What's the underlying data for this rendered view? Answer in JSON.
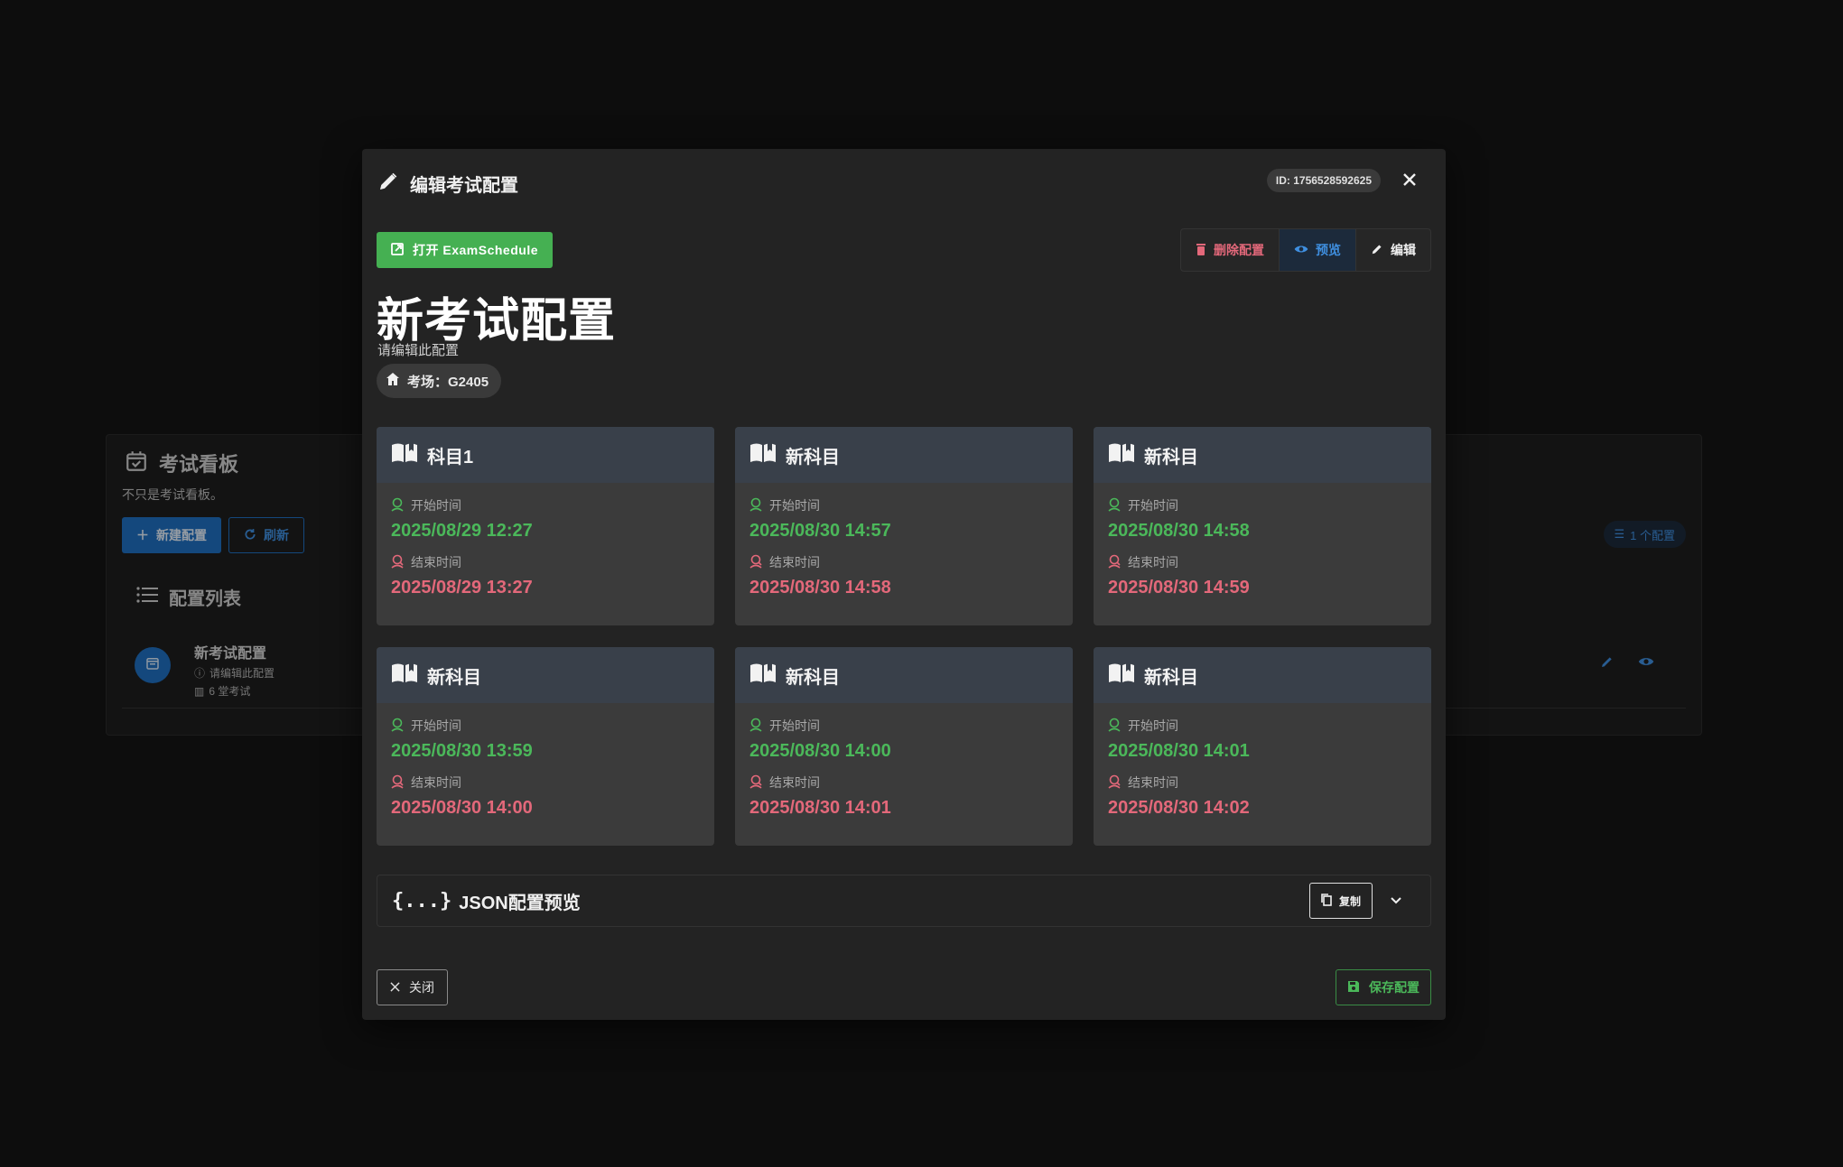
{
  "background": {
    "app_title": "考试看板",
    "app_subtitle": "不只是考试看板。",
    "new_config_label": "新建配置",
    "refresh_label": "刷新",
    "config_count": "1 个配置",
    "list_title": "配置列表",
    "item": {
      "name": "新考试配置",
      "desc": "请编辑此配置",
      "count": "6 堂考试"
    }
  },
  "dialog": {
    "title": "编辑考试配置",
    "id_chip": "ID: 1756528592625",
    "open_button": "打开 ExamSchedule",
    "actions": {
      "delete": "删除配置",
      "preview": "预览",
      "edit": "编辑"
    },
    "config_name": "新考试配置",
    "config_desc": "请编辑此配置",
    "room_chip": "考场：G2405",
    "start_label": "开始时间",
    "end_label": "结束时间",
    "exams": [
      {
        "name": "科目1",
        "start": "2025/08/29 12:27",
        "end": "2025/08/29 13:27"
      },
      {
        "name": "新科目",
        "start": "2025/08/30 14:57",
        "end": "2025/08/30 14:58"
      },
      {
        "name": "新科目",
        "start": "2025/08/30 14:58",
        "end": "2025/08/30 14:59"
      },
      {
        "name": "新科目",
        "start": "2025/08/30 13:59",
        "end": "2025/08/30 14:00"
      },
      {
        "name": "新科目",
        "start": "2025/08/30 14:00",
        "end": "2025/08/30 14:01"
      },
      {
        "name": "新科目",
        "start": "2025/08/30 14:01",
        "end": "2025/08/30 14:02"
      }
    ],
    "json_preview": {
      "braces": "{...}",
      "title": "JSON配置预览",
      "copy_label": "复制"
    },
    "close_label": "关闭",
    "save_label": "保存配置"
  },
  "colors": {
    "accent_blue": "#1f6fc1",
    "success_green": "#45b052",
    "danger_red": "#e3687a",
    "start_time_green": "#4bb85a"
  }
}
